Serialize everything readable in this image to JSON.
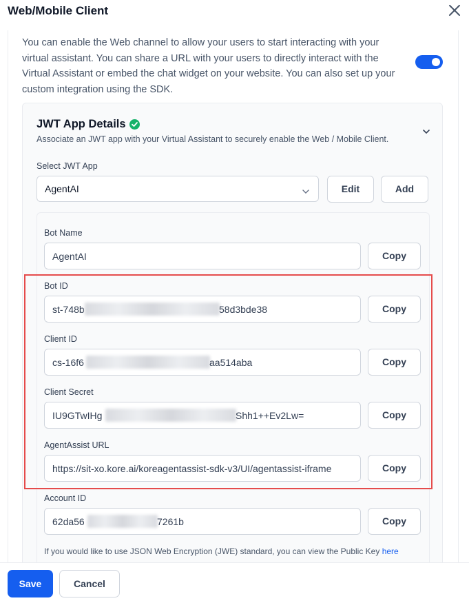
{
  "dialog": {
    "title": "Web/Mobile Client"
  },
  "intro": {
    "text": "You can enable the Web channel to allow your users to start interacting with your virtual assistant. You can share a URL with your users to directly interact with the Virtual Assistant or embed the chat widget on your website. You can also set up your custom integration using the SDK.",
    "enabled": true
  },
  "jwt_card": {
    "title": "JWT App Details",
    "subtitle": "Associate an JWT app with your Virtual Assistant to securely enable the Web / Mobile Client.",
    "select_label": "Select JWT App",
    "selected_app": "AgentAI",
    "edit_label": "Edit",
    "add_label": "Add"
  },
  "fields": {
    "bot_name": {
      "label": "Bot Name",
      "value": "AgentAI",
      "copy": "Copy"
    },
    "bot_id": {
      "label": "Bot ID",
      "prefix": "st-748b",
      "suffix": "58d3bde38",
      "copy": "Copy"
    },
    "client_id": {
      "label": "Client ID",
      "prefix": "cs-16f6",
      "suffix": "aa514aba",
      "copy": "Copy"
    },
    "client_secret": {
      "label": "Client Secret",
      "prefix": "IU9GTwIHg",
      "suffix": "Shh1++Ev2Lw=",
      "copy": "Copy"
    },
    "agentassist_url": {
      "label": "AgentAssist URL",
      "value": "https://sit-xo.kore.ai/koreagentassist-sdk-v3/UI/agentassist-iframe",
      "copy": "Copy"
    },
    "account_id": {
      "label": "Account ID",
      "prefix": "62da56",
      "suffix": "7261b",
      "copy": "Copy"
    }
  },
  "note": {
    "text": "If you would like to use JSON Web Encryption (JWE) standard, you can view the Public Key",
    "link": "here"
  },
  "footer": {
    "save_label": "Save",
    "cancel_label": "Cancel"
  },
  "colors": {
    "primary": "#155eef",
    "highlight": "#e54b4b",
    "success": "#17b26a"
  }
}
